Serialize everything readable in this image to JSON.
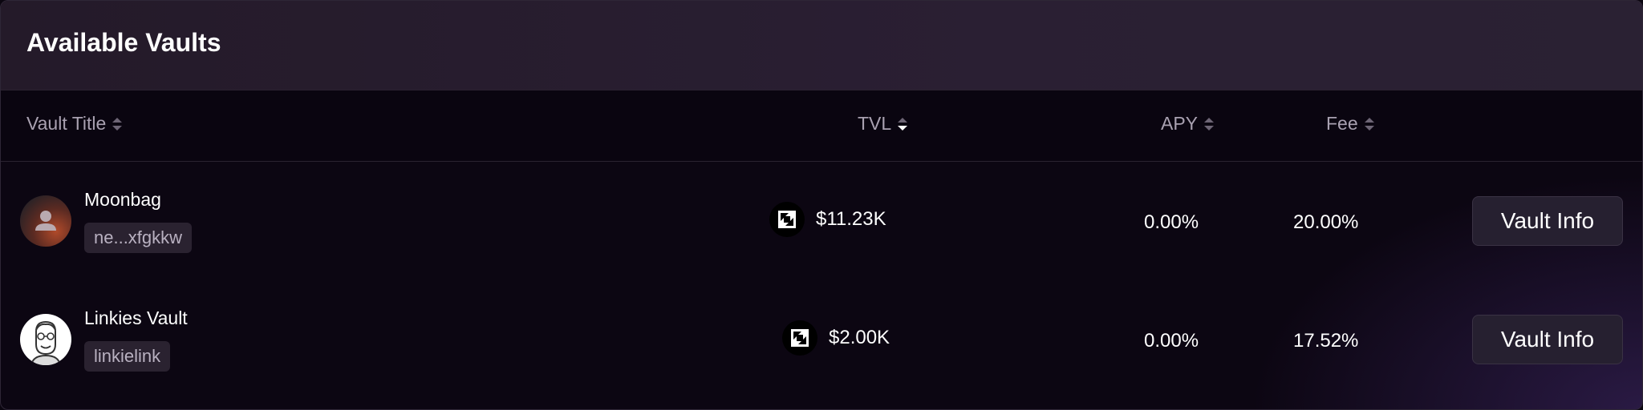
{
  "header": {
    "title": "Available Vaults"
  },
  "columns": {
    "vault_title": "Vault Title",
    "tvl": "TVL",
    "apy": "APY",
    "fee": "Fee"
  },
  "rows": [
    {
      "name": "Moonbag",
      "id_chip": "ne...xfgkkw",
      "avatar": "user-silhouette-icon",
      "token_icon": "token-icon",
      "tvl": "$11.23K",
      "apy": "0.00%",
      "fee": "20.00%",
      "action": "Vault Info"
    },
    {
      "name": "Linkies Vault",
      "id_chip": "linkielink",
      "avatar": "cartoon-face-avatar",
      "token_icon": "token-icon",
      "tvl": "$2.00K",
      "apy": "0.00%",
      "fee": "17.52%",
      "action": "Vault Info"
    }
  ],
  "colors": {
    "background": "#0c0612",
    "header": "#2a1f33",
    "accent_glow": "#2a1a44"
  }
}
